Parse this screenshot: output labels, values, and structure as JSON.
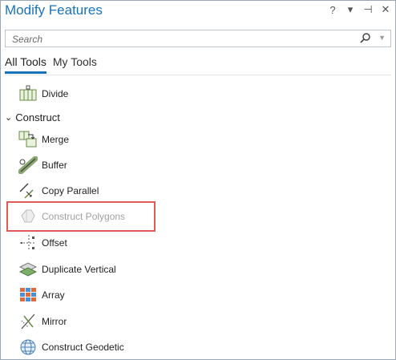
{
  "panel": {
    "title": "Modify Features",
    "help_label": "?",
    "menu_label": "▾",
    "pin_label": "⊣",
    "close_label": "✕"
  },
  "search": {
    "placeholder": "Search"
  },
  "tabs": [
    {
      "label": "All Tools",
      "active": true
    },
    {
      "label": "My Tools",
      "active": false
    }
  ],
  "tools_top": [
    {
      "label": "Divide",
      "icon": "divide-icon"
    }
  ],
  "group": {
    "label": "Construct",
    "expanded": true
  },
  "tools": [
    {
      "label": "Merge",
      "icon": "merge-icon",
      "enabled": true
    },
    {
      "label": "Buffer",
      "icon": "buffer-icon",
      "enabled": true
    },
    {
      "label": "Copy Parallel",
      "icon": "copy-parallel-icon",
      "enabled": true
    },
    {
      "label": "Construct Polygons",
      "icon": "construct-polygons-icon",
      "enabled": false
    },
    {
      "label": "Offset",
      "icon": "offset-icon",
      "enabled": true
    },
    {
      "label": "Duplicate Vertical",
      "icon": "duplicate-vertical-icon",
      "enabled": true
    },
    {
      "label": "Array",
      "icon": "array-icon",
      "enabled": true
    },
    {
      "label": "Mirror",
      "icon": "mirror-icon",
      "enabled": true
    },
    {
      "label": "Construct Geodetic",
      "icon": "construct-geodetic-icon",
      "enabled": true
    }
  ],
  "colors": {
    "accent": "#1a73b8",
    "highlight": "#e05a5a",
    "disabled": "#a0a0a0"
  }
}
